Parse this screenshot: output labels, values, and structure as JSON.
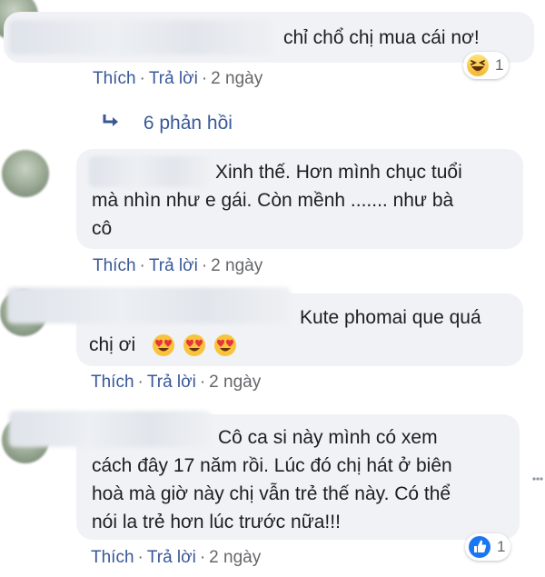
{
  "comments": [
    {
      "text": "chỉ chổ chị mua cái nơ!",
      "actions": {
        "like": "Thích",
        "reply": "Trả lời",
        "time": "2 ngày"
      },
      "reaction": {
        "icon": "haha-icon",
        "count": "1"
      }
    },
    {
      "lines": [
        "Xinh thế. Hơn mình chục tuổi",
        "mà nhìn như e gái. Còn mềnh ....... như bà",
        "cô"
      ],
      "actions": {
        "like": "Thích",
        "reply": "Trả lời",
        "time": "2 ngày"
      }
    },
    {
      "lines": [
        "Kute phomai que quá",
        "chị ơi"
      ],
      "emoji": [
        "heart-eyes-icon",
        "heart-eyes-icon",
        "heart-eyes-icon"
      ],
      "actions": {
        "like": "Thích",
        "reply": "Trả lời",
        "time": "2 ngày"
      }
    },
    {
      "lines": [
        "Cô ca si này mình có xem",
        "cách đây 17 năm rồi. Lúc đó chị hát ở biên",
        "hoà mà giờ này chị vẫn trẻ thế này. Có thể",
        "nói la trẻ hơn lúc trước nữa!!!"
      ],
      "actions": {
        "like": "Thích",
        "reply": "Trả lời",
        "time": "2 ngày"
      },
      "reaction": {
        "icon": "like-icon",
        "count": "1"
      }
    }
  ],
  "replies_label": "6 phản hồi",
  "colors": {
    "link": "#385898",
    "bubble": "#f0f2f5",
    "meta": "#65676b",
    "like_blue": "#1877f2"
  }
}
